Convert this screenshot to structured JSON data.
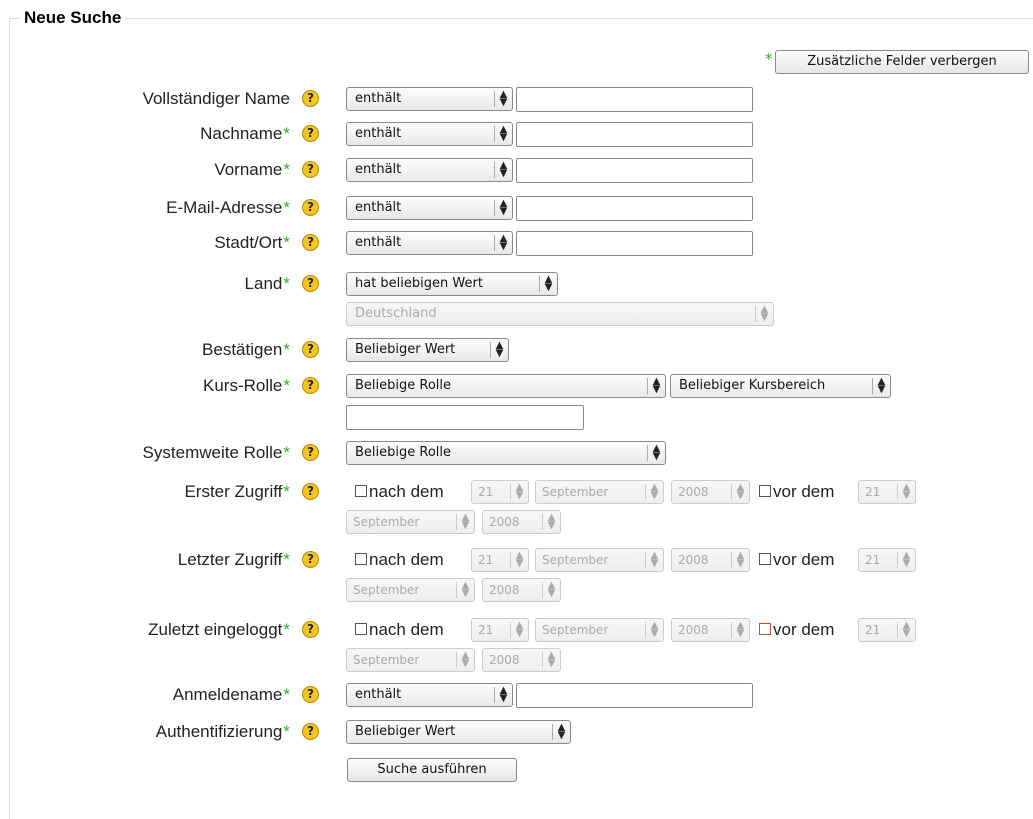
{
  "form": {
    "legend": "Neue Suche",
    "toggle_button": "Zusätzliche Felder verbergen",
    "submit_button": "Suche ausführen",
    "required_mark": "*",
    "help_glyph": "?"
  },
  "fields": {
    "fullname": {
      "label": "Vollständiger Name",
      "operator": "enthält",
      "value": ""
    },
    "lastname": {
      "label": "Nachname",
      "operator": "enthält",
      "value": ""
    },
    "firstname": {
      "label": "Vorname",
      "operator": "enthält",
      "value": ""
    },
    "email": {
      "label": "E-Mail-Adresse",
      "operator": "enthält",
      "value": ""
    },
    "city": {
      "label": "Stadt/Ort",
      "operator": "enthält",
      "value": ""
    },
    "country": {
      "label": "Land",
      "operator": "hat beliebigen Wert",
      "country_value": "Deutschland"
    },
    "confirmed": {
      "label": "Bestätigen",
      "value": "Beliebiger Wert"
    },
    "courserole": {
      "label": "Kurs-Rolle",
      "role": "Beliebige Rolle",
      "category": "Beliebiger Kursbereich",
      "value": ""
    },
    "systemrole": {
      "label": "Systemweite Rolle",
      "role": "Beliebige Rolle"
    },
    "firstaccess": {
      "label": "Erster Zugriff"
    },
    "lastaccess": {
      "label": "Letzter Zugriff"
    },
    "lastlogin": {
      "label": "Zuletzt eingeloggt"
    },
    "username": {
      "label": "Anmeldename",
      "operator": "enthält",
      "value": ""
    },
    "auth": {
      "label": "Authentifizierung",
      "value": "Beliebiger Wert"
    }
  },
  "date": {
    "after_label": "nach dem",
    "before_label": "vor dem",
    "day": "21",
    "month": "September",
    "year": "2008"
  },
  "icons": {
    "help": "help-question-icon",
    "dropdown": "up-down-arrows-icon"
  },
  "colors": {
    "required": "#33aa33",
    "help_bg": "#f7c51b",
    "focused_checkbox": "#c0502a"
  }
}
